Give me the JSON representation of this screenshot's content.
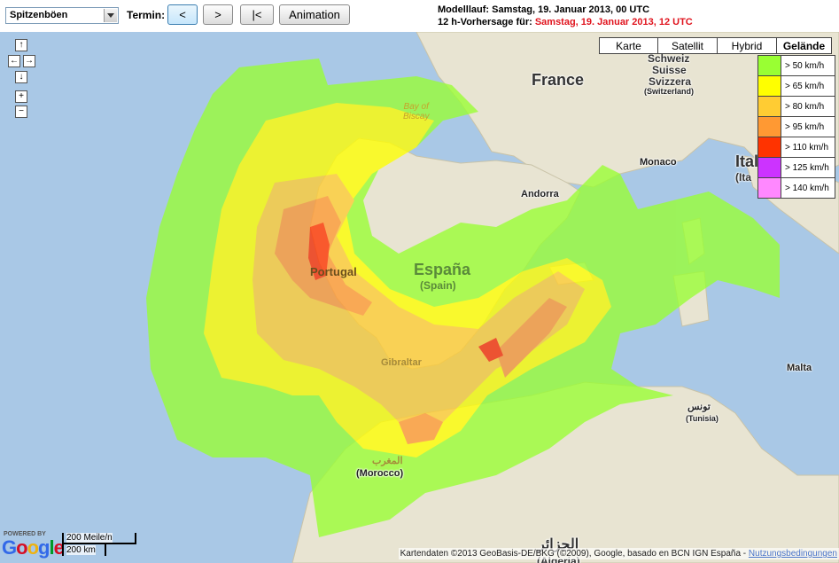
{
  "toolbar": {
    "parameter": "Spitzenböen",
    "termin_label": "Termin:",
    "btn_prev": "<",
    "btn_next": ">",
    "btn_first": "|<",
    "btn_animation": "Animation"
  },
  "run_info": {
    "modellauf_prefix": "Modelllauf: ",
    "modellauf_value": "Samstag, 19. Januar 2013, 00 UTC",
    "forecast_prefix": "12 h-Vorhersage für: ",
    "forecast_value": "Samstag, 19. Januar 2013, 12 UTC"
  },
  "map_types": [
    "Karte",
    "Satellit",
    "Hybrid",
    "Gelände"
  ],
  "map_type_selected": "Gelände",
  "legend": [
    {
      "label": "> 50 km/h",
      "color": "#99ff33"
    },
    {
      "label": "> 65 km/h",
      "color": "#ffff00"
    },
    {
      "label": "> 80 km/h",
      "color": "#ffcc33"
    },
    {
      "label": "> 95 km/h",
      "color": "#ff9933"
    },
    {
      "label": "> 110 km/h",
      "color": "#ff3300"
    },
    {
      "label": "> 125 km/h",
      "color": "#cc33ff"
    },
    {
      "label": "> 140 km/h",
      "color": "#ff88ff"
    }
  ],
  "places": {
    "france": "France",
    "schweiz": "Schweiz",
    "suisse": "Suisse",
    "svizzera": "Svizzera",
    "switzerland": "(Switzerland)",
    "monaco": "Monaco",
    "andorra": "Andorra",
    "italia": "Ital",
    "italy": "(Ita",
    "portugal": "Portugal",
    "espana": "España",
    "spain": "(Spain)",
    "gibraltar": "Gibraltar",
    "bay_of_biscay": "Bay of\nBiscay",
    "malta": "Malta",
    "tunisia_ar": "تونس",
    "tunisia": "(Tunisia)",
    "morocco_ar": "المغرب",
    "morocco": "(Morocco)",
    "algeria_ar": "الجزائر",
    "algeria": "(Algeria)"
  },
  "footer": {
    "powered_by": "POWERED BY",
    "google": "Google",
    "scale_miles": "200 Meile/n",
    "scale_km": "200 km",
    "copyright": "Kartendaten ©2013 GeoBasis-DE/BKG (©2009), Google, basado en BCN IGN España - ",
    "terms_link": "Nutzungsbedingungen"
  },
  "colors": {
    "sea": "#a9c8e6",
    "land": "#e8e4d2",
    "gust_50": "#99ff33",
    "gust_65": "#ffff00",
    "gust_80": "#ffcc33",
    "gust_95": "#ff9933",
    "gust_110": "#ff3300"
  }
}
